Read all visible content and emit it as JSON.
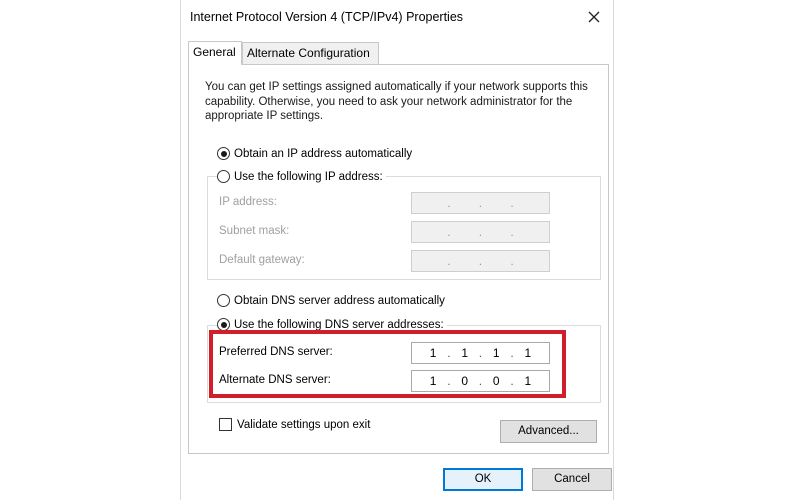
{
  "window": {
    "title": "Internet Protocol Version 4 (TCP/IPv4) Properties"
  },
  "tabs": [
    {
      "label": "General",
      "active": true
    },
    {
      "label": "Alternate Configuration",
      "active": false
    }
  ],
  "intro_text": "You can get IP settings assigned automatically if your network supports this capability. Otherwise, you need to ask your network administrator for the appropriate IP settings.",
  "ip_section": {
    "auto_label": "Obtain an IP address automatically",
    "auto_selected": true,
    "manual_label": "Use the following IP address:",
    "manual_selected": false,
    "fields": [
      {
        "label": "IP address:",
        "value": [
          "",
          "",
          "",
          ""
        ]
      },
      {
        "label": "Subnet mask:",
        "value": [
          "",
          "",
          "",
          ""
        ]
      },
      {
        "label": "Default gateway:",
        "value": [
          "",
          "",
          "",
          ""
        ]
      }
    ]
  },
  "dns_section": {
    "auto_label": "Obtain DNS server address automatically",
    "auto_selected": false,
    "manual_label": "Use the following DNS server addresses:",
    "manual_selected": true,
    "preferred": {
      "label": "Preferred DNS server:",
      "value": [
        "1",
        "1",
        "1",
        "1"
      ]
    },
    "alternate": {
      "label": "Alternate DNS server:",
      "value": [
        "1",
        "0",
        "0",
        "1"
      ]
    }
  },
  "validate": {
    "label": "Validate settings upon exit",
    "checked": false
  },
  "buttons": {
    "advanced": "Advanced...",
    "ok": "OK",
    "cancel": "Cancel"
  },
  "colors": {
    "highlight": "#d01e2a",
    "ok_border": "#0078d7"
  }
}
